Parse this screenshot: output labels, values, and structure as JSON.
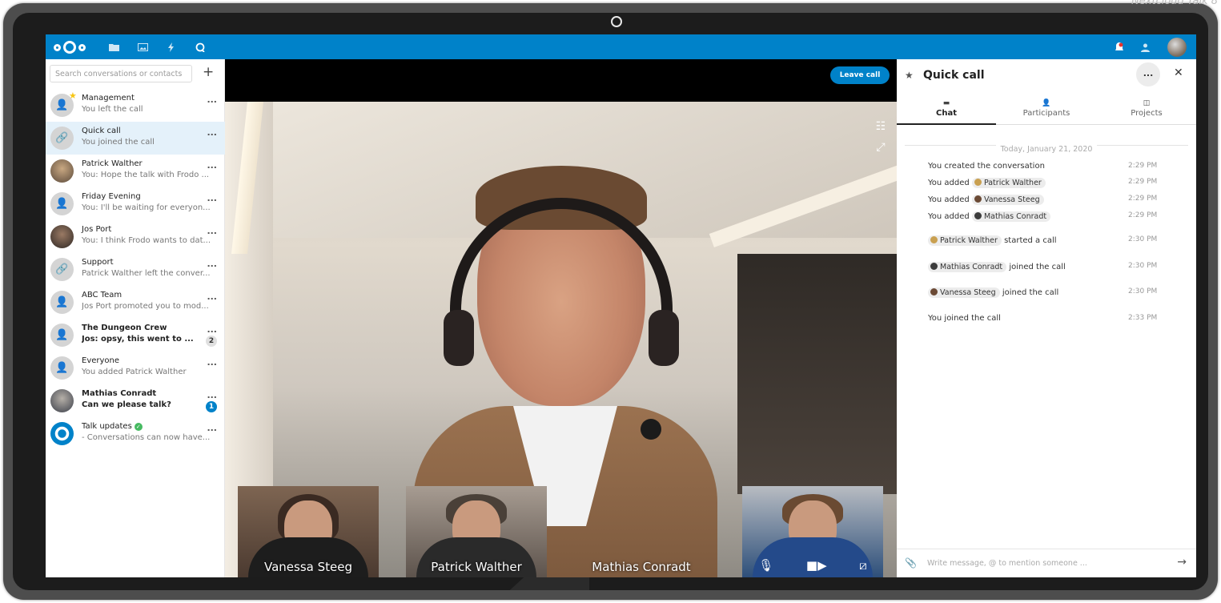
{
  "corner_text": "Nextcloud Talk 8",
  "topbar": {
    "apps": [
      "files-icon",
      "photos-icon",
      "activity-icon",
      "talk-icon"
    ]
  },
  "sidebar": {
    "search_placeholder": "Search conversations or contacts",
    "add_label": "+",
    "conversations": [
      {
        "name": "Management",
        "subtitle": "You left the call",
        "badge": ""
      },
      {
        "name": "Quick call",
        "subtitle": "You joined the call",
        "badge": ""
      },
      {
        "name": "Patrick Walther",
        "subtitle": "You: Hope the talk with Frodo ...",
        "badge": ""
      },
      {
        "name": "Friday Evening",
        "subtitle": "You: I'll be waiting for everyon...",
        "badge": ""
      },
      {
        "name": "Jos Port",
        "subtitle": "You: I think Frodo wants to dat...",
        "badge": ""
      },
      {
        "name": "Support",
        "subtitle": "Patrick Walther left the conver...",
        "badge": ""
      },
      {
        "name": "ABC Team",
        "subtitle": "Jos Port promoted you to mod...",
        "badge": ""
      },
      {
        "name": "The Dungeon Crew",
        "subtitle": "Jos: opsy, this went to ...",
        "badge": "2"
      },
      {
        "name": "Everyone",
        "subtitle": "You added Patrick Walther",
        "badge": ""
      },
      {
        "name": "Mathias Conradt",
        "subtitle": "Can we please talk?",
        "badge": "1"
      },
      {
        "name": "Talk updates",
        "subtitle": "- Conversations can now have...",
        "badge": ""
      }
    ],
    "more_label": "..."
  },
  "video": {
    "leave_label": "Leave call",
    "participants": [
      "Vanessa Steeg",
      "Patrick Walther",
      "Mathias Conradt"
    ]
  },
  "right": {
    "title": "Quick call",
    "more_label": "...",
    "close_label": "✕",
    "tabs": [
      "Chat",
      "Participants",
      "Projects"
    ],
    "date": "Today, January 21, 2020",
    "messages": [
      {
        "pre": "You created the conversation",
        "chip": "",
        "post": "",
        "time": "2:29 PM"
      },
      {
        "pre": "You added",
        "chip": "Patrick Walther",
        "post": "",
        "time": "2:29 PM"
      },
      {
        "pre": "You added",
        "chip": "Vanessa Steeg",
        "post": "",
        "time": "2:29 PM"
      },
      {
        "pre": "You added",
        "chip": "Mathias Conradt",
        "post": "",
        "time": "2:29 PM"
      },
      {
        "pre": "",
        "chip": "Patrick Walther",
        "post": "started a call",
        "time": "2:30 PM"
      },
      {
        "pre": "",
        "chip": "Mathias Conradt",
        "post": "joined the call",
        "time": "2:30 PM"
      },
      {
        "pre": "",
        "chip": "Vanessa Steeg",
        "post": "joined the call",
        "time": "2:30 PM"
      },
      {
        "pre": "You joined the call",
        "chip": "",
        "post": "",
        "time": "2:33 PM"
      }
    ],
    "composer_placeholder": "Write message, @ to mention someone ..."
  },
  "colors": {
    "accent": "#0082c9",
    "active_row": "#e4f1fa",
    "success": "#46ba61"
  }
}
